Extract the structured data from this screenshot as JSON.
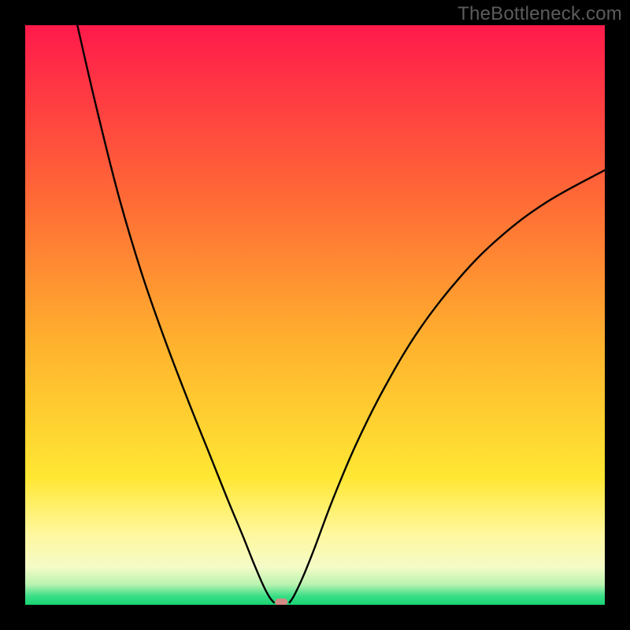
{
  "watermark": "TheBottleneck.com",
  "chart_data": {
    "type": "line",
    "title": "",
    "xlabel": "",
    "ylabel": "",
    "xlim": [
      0,
      100
    ],
    "ylim": [
      0,
      100
    ],
    "grid": false,
    "legend": false,
    "annotations": [],
    "gradient_stops": [
      {
        "offset": 0.0,
        "color": "#ff1a4b"
      },
      {
        "offset": 0.3,
        "color": "#ff6a36"
      },
      {
        "offset": 0.55,
        "color": "#ffb22e"
      },
      {
        "offset": 0.78,
        "color": "#ffe733"
      },
      {
        "offset": 0.88,
        "color": "#fff8a0"
      },
      {
        "offset": 0.935,
        "color": "#f4fbc7"
      },
      {
        "offset": 0.965,
        "color": "#b9f3b0"
      },
      {
        "offset": 0.985,
        "color": "#39de86"
      },
      {
        "offset": 1.0,
        "color": "#19d472"
      }
    ],
    "curve_left": [
      {
        "x": 9.0,
        "y": 100.0
      },
      {
        "x": 12.0,
        "y": 87.0
      },
      {
        "x": 16.0,
        "y": 71.0
      },
      {
        "x": 20.0,
        "y": 57.5
      },
      {
        "x": 24.0,
        "y": 46.0
      },
      {
        "x": 28.0,
        "y": 35.5
      },
      {
        "x": 32.0,
        "y": 25.5
      },
      {
        "x": 35.0,
        "y": 18.0
      },
      {
        "x": 37.5,
        "y": 12.0
      },
      {
        "x": 39.5,
        "y": 7.0
      },
      {
        "x": 41.0,
        "y": 3.5
      },
      {
        "x": 42.1,
        "y": 1.4
      },
      {
        "x": 42.9,
        "y": 0.4
      }
    ],
    "curve_right": [
      {
        "x": 45.6,
        "y": 0.4
      },
      {
        "x": 46.4,
        "y": 1.6
      },
      {
        "x": 48.0,
        "y": 5.0
      },
      {
        "x": 50.0,
        "y": 10.0
      },
      {
        "x": 53.0,
        "y": 18.0
      },
      {
        "x": 57.0,
        "y": 27.5
      },
      {
        "x": 62.0,
        "y": 37.5
      },
      {
        "x": 68.0,
        "y": 47.5
      },
      {
        "x": 75.0,
        "y": 56.5
      },
      {
        "x": 82.0,
        "y": 63.5
      },
      {
        "x": 90.0,
        "y": 69.5
      },
      {
        "x": 100.0,
        "y": 75.0
      }
    ],
    "marker": {
      "x": 44.2,
      "y": 0.0,
      "color": "#d38b87"
    }
  }
}
